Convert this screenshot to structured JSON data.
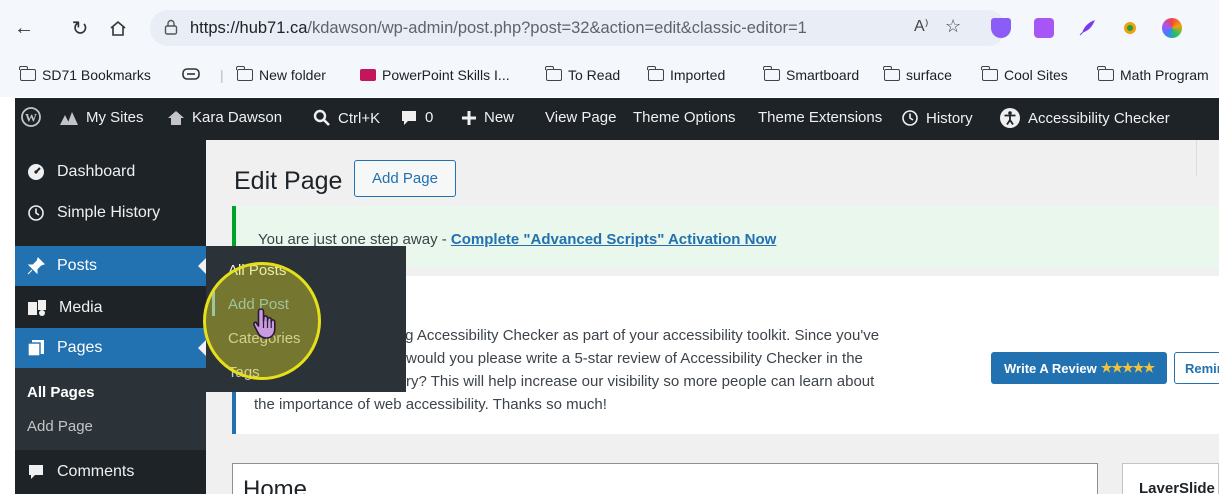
{
  "browser": {
    "url_host": "https://hub71.ca",
    "url_path": "/kdawson/wp-admin/post.php?post=32&action=edit&classic-editor=1",
    "read_aloud": "A⁾",
    "bookmarks": [
      {
        "label": "SD71 Bookmarks"
      },
      {
        "label": ""
      },
      {
        "label": "New folder"
      },
      {
        "label": "PowerPoint Skills I..."
      },
      {
        "label": "To Read"
      },
      {
        "label": "Imported"
      },
      {
        "label": "Smartboard"
      },
      {
        "label": "surface"
      },
      {
        "label": "Cool Sites"
      },
      {
        "label": "Math Program"
      }
    ]
  },
  "adminbar": {
    "my_sites": "My Sites",
    "site_name": "Kara Dawson",
    "search": "Ctrl+K",
    "comments_count": "0",
    "new": "New",
    "view_page": "View Page",
    "theme_options": "Theme Options",
    "theme_extensions": "Theme Extensions",
    "history": "History",
    "accessibility_checker": "Accessibility Checker"
  },
  "sidebar": {
    "dashboard": "Dashboard",
    "simple_history": "Simple History",
    "posts": "Posts",
    "media": "Media",
    "pages": "Pages",
    "all_pages": "All Pages",
    "add_page": "Add Page",
    "comments": "Comments"
  },
  "flyout": {
    "all_posts": "All Posts",
    "add_post": "Add Post",
    "categories": "Categories",
    "tags": "Tags"
  },
  "main": {
    "title": "Edit Page",
    "add_page_button": "Add Page",
    "notice_text": "You are just one step away - ",
    "notice_link": "Complete \"Advanced Scripts\" Activation Now",
    "review_lines": [
      "sing Accessibility Checker as part of your accessibility toolkit. Since you've",
      "le, would you please write a 5-star review of Accessibility Checker in the",
      "ctory? This will help increase our visibility so more people can learn about",
      "the importance of web accessibility. Thanks so much!"
    ],
    "write_review": "Write A Review",
    "stars": "★★★★★",
    "remind": "Remind M",
    "post_title": "Home",
    "side_box": "LaverSlide"
  },
  "colors": {
    "wp_dark": "#1d2327",
    "wp_blue": "#2271b1",
    "highlight": "#e6e01a"
  }
}
